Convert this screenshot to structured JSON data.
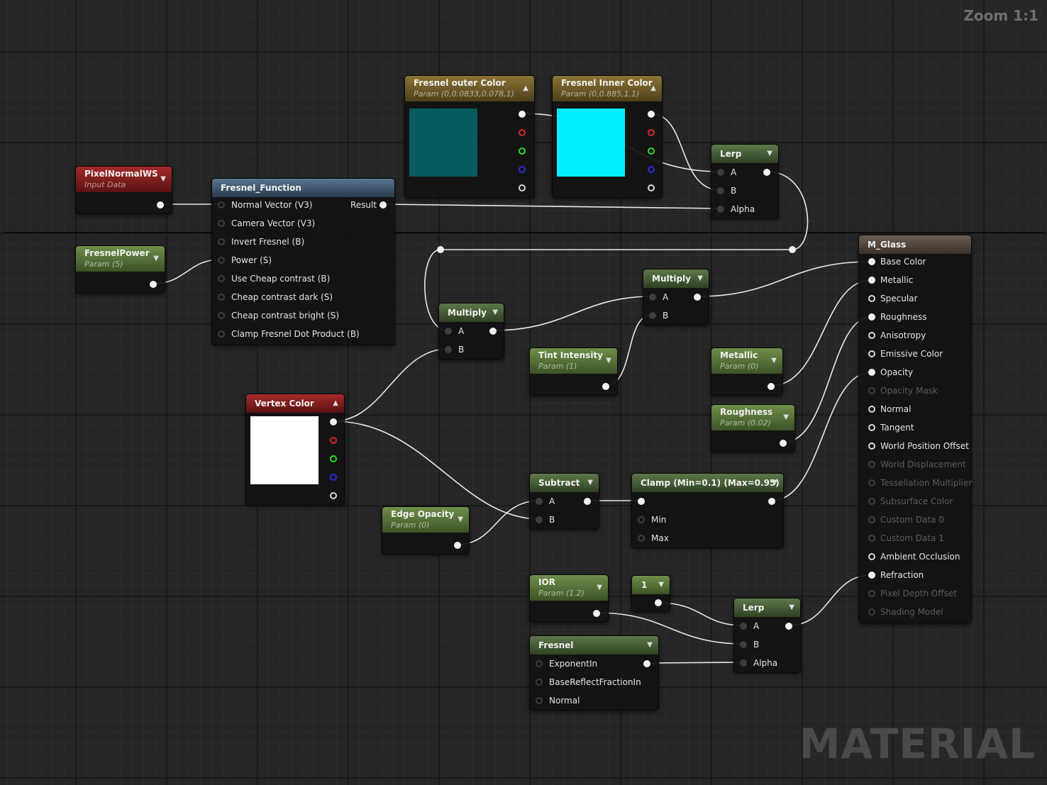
{
  "zoom_label": "Zoom 1:1",
  "watermark": "MATERIAL",
  "colors": {
    "fresnel_outer_swatch": "#075c5e",
    "fresnel_inner_swatch": "#00efff",
    "vertex_color_swatch": "#ffffff"
  },
  "nodes": {
    "pixel_normal": {
      "title": "PixelNormalWS",
      "sub": "Input Data"
    },
    "fresnel_power": {
      "title": "FresnelPower",
      "sub": "Param (5)"
    },
    "fresnel_function": {
      "title": "Fresnel_Function",
      "inputs": [
        "Normal Vector (V3)",
        "Camera Vector (V3)",
        "Invert Fresnel (B)",
        "Power (S)",
        "Use Cheap contrast (B)",
        "Cheap contrast dark (S)",
        "Cheap contrast bright (S)",
        "Clamp Fresnel Dot Product (B)"
      ],
      "output": "Result"
    },
    "fresnel_outer": {
      "title": "Fresnel outer Color",
      "sub": "Param (0,0.0833,0.078,1)"
    },
    "fresnel_inner": {
      "title": "Fresnel Inner Color",
      "sub": "Param (0,0.885,1,1)"
    },
    "lerp_top": {
      "title": "Lerp",
      "inputs": [
        "A",
        "B",
        "Alpha"
      ]
    },
    "multiply_left": {
      "title": "Multiply",
      "inputs": [
        "A",
        "B"
      ]
    },
    "multiply_right": {
      "title": "Multiply",
      "inputs": [
        "A",
        "B"
      ]
    },
    "tint_intensity": {
      "title": "Tint Intensity",
      "sub": "Param (1)"
    },
    "metallic": {
      "title": "Metallic",
      "sub": "Param (0)"
    },
    "roughness": {
      "title": "Roughness",
      "sub": "Param (0.02)"
    },
    "vertex_color": {
      "title": "Vertex Color"
    },
    "edge_opacity": {
      "title": "Edge Opacity",
      "sub": "Param (0)"
    },
    "subtract": {
      "title": "Subtract",
      "inputs": [
        "A",
        "B"
      ]
    },
    "clamp": {
      "title": "Clamp (Min=0.1) (Max=0.95)",
      "inputs": [
        "Min",
        "Max"
      ]
    },
    "ior": {
      "title": "IOR",
      "sub": "Param (1.2)"
    },
    "constant": {
      "title": "1"
    },
    "lerp_bottom": {
      "title": "Lerp",
      "inputs": [
        "A",
        "B",
        "Alpha"
      ]
    },
    "fresnel": {
      "title": "Fresnel",
      "inputs": [
        "ExponentIn",
        "BaseReflectFractionIn",
        "Normal"
      ]
    },
    "m_glass": {
      "title": "M_Glass",
      "inputs": [
        "Base Color",
        "Metallic",
        "Specular",
        "Roughness",
        "Anisotropy",
        "Emissive Color",
        "Opacity",
        "Opacity Mask",
        "Normal",
        "Tangent",
        "World Position Offset",
        "World Displacement",
        "Tessellation Multiplier",
        "Subsurface Color",
        "Custom Data 0",
        "Custom Data 1",
        "Ambient Occlusion",
        "Refraction",
        "Pixel Depth Offset",
        "Shading Model"
      ]
    }
  }
}
